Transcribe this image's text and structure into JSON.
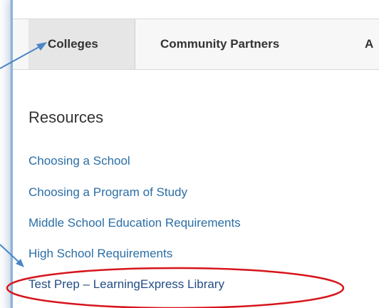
{
  "nav": {
    "tabs": [
      {
        "label": "Colleges",
        "active": true
      },
      {
        "label": "Community Partners",
        "active": false
      },
      {
        "label": "A",
        "active": false
      }
    ]
  },
  "resources": {
    "heading": "Resources",
    "links": [
      {
        "label": "Choosing a School"
      },
      {
        "label": "Choosing a Program of Study"
      },
      {
        "label": "Middle School Education Requirements"
      },
      {
        "label": "High School Requirements"
      },
      {
        "label": "Test Prep – LearningExpress Library",
        "highlighted": true
      }
    ]
  },
  "annotations": {
    "arrow_color": "#4a86c8",
    "highlight_color": "#d7141c"
  }
}
